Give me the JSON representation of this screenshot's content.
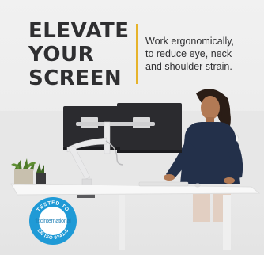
{
  "headline": {
    "line1": "ELEVATE",
    "line2": "YOUR",
    "line3": "SCREEN"
  },
  "tagline": {
    "line1": "Work ergonomically,",
    "line2": "to reduce eye, neck",
    "line3": "and shoulder strain."
  },
  "badge": {
    "top_text": "TESTED TO",
    "brand": "fiscinternational",
    "bottom_text": "EN ISO 9241-5"
  },
  "colors": {
    "accent": "#e6b32b",
    "headline": "#2f2f31",
    "badge_blue": "#1f9ad6",
    "arm": "#e9e9ea",
    "monitor": "#2b2b2f",
    "shirt": "#23304a"
  },
  "icons": [
    "monitor-arm-illustration",
    "dual-monitors",
    "potted-plants",
    "person-at-desk",
    "certification-badge"
  ]
}
